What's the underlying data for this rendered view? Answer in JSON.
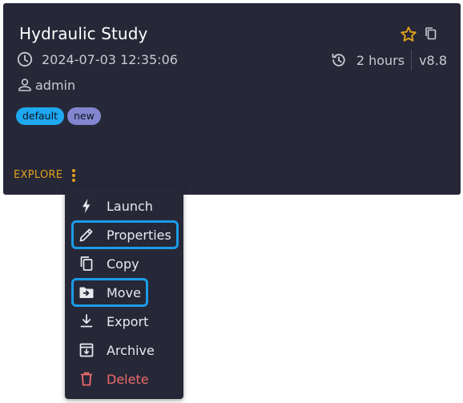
{
  "card": {
    "title": "Hydraulic Study",
    "timestamp": "2024-07-03 12:35:06",
    "duration": "2 hours",
    "version": "v8.8",
    "user": "admin",
    "tags": [
      "default",
      "new"
    ],
    "explore_label": "EXPLORE",
    "icons": {
      "favorite": "star-outline-icon",
      "copy": "copy-icon",
      "time": "clock-icon",
      "history": "history-icon",
      "user": "user-icon",
      "more": "vertical-dots-icon"
    }
  },
  "menu": {
    "items": [
      {
        "label": "Launch",
        "icon": "lightning-icon"
      },
      {
        "label": "Properties",
        "icon": "pencil-icon"
      },
      {
        "label": "Copy",
        "icon": "copy-icon"
      },
      {
        "label": "Move",
        "icon": "folder-move-icon"
      },
      {
        "label": "Export",
        "icon": "export-icon"
      },
      {
        "label": "Archive",
        "icon": "archive-icon"
      },
      {
        "label": "Delete",
        "icon": "trash-icon"
      }
    ]
  },
  "colors": {
    "card_bg": "#262838",
    "accent": "#e3a21a",
    "tag_default": "#1ea8ef",
    "tag_new": "#8286cf",
    "highlight": "#1c9be8",
    "danger": "#ec6a6a"
  }
}
